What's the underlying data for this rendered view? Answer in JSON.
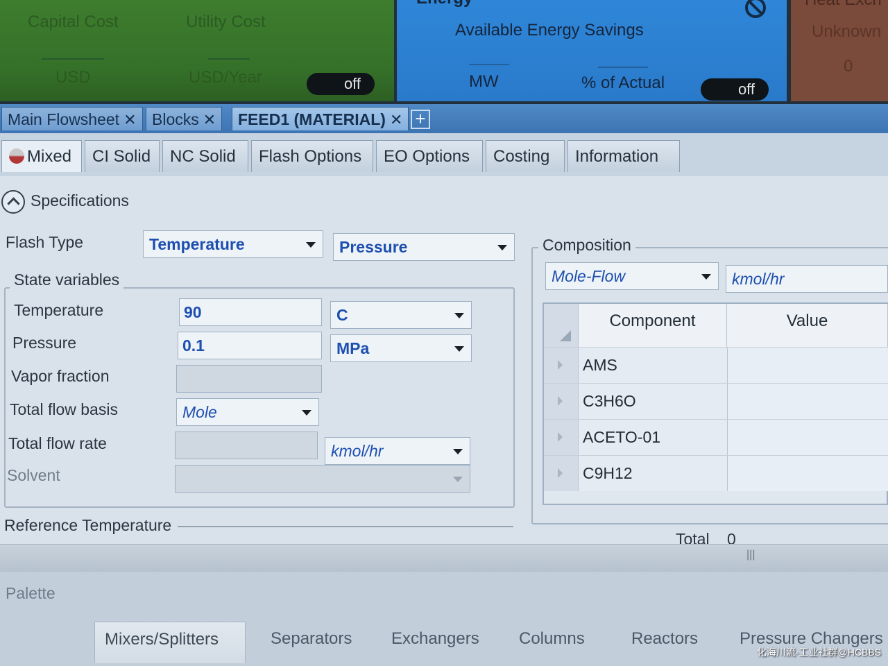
{
  "dashboard": {
    "cost": {
      "col1_title": "Capital Cost",
      "col2_title": "Utility Cost",
      "col1_unit": "USD",
      "col2_unit": "USD/Year",
      "toggle": "off"
    },
    "energy": {
      "title": "Energy",
      "subtitle": "Available Energy Savings",
      "col1_unit": "MW",
      "col2_unit": "% of Actual",
      "toggle": "off"
    },
    "utility": {
      "title": "Heat Exch",
      "subtitle": "Unknown",
      "value": "0"
    }
  },
  "doc_tabs": [
    {
      "label": "Main Flowsheet"
    },
    {
      "label": "Blocks"
    },
    {
      "label": "FEED1 (MATERIAL)"
    }
  ],
  "form_tabs": [
    {
      "label": "Mixed"
    },
    {
      "label": "CI Solid"
    },
    {
      "label": "NC Solid"
    },
    {
      "label": "Flash Options"
    },
    {
      "label": "EO Options"
    },
    {
      "label": "Costing"
    },
    {
      "label": "Information"
    }
  ],
  "specifications": {
    "section_title": "Specifications",
    "flash_type_label": "Flash Type",
    "flash_type_1": "Temperature",
    "flash_type_2": "Pressure",
    "state_variables_title": "State variables",
    "temperature_label": "Temperature",
    "temperature_value": "90",
    "temperature_unit": "C",
    "pressure_label": "Pressure",
    "pressure_value": "0.1",
    "pressure_unit": "MPa",
    "vapor_fraction_label": "Vapor fraction",
    "total_flow_basis_label": "Total flow basis",
    "total_flow_basis_value": "Mole",
    "total_flow_rate_label": "Total flow rate",
    "total_flow_rate_unit": "kmol/hr",
    "solvent_label": "Solvent",
    "reference_temperature_title": "Reference Temperature"
  },
  "composition": {
    "title": "Composition",
    "basis": "Mole-Flow",
    "unit": "kmol/hr",
    "columns": [
      "Component",
      "Value"
    ],
    "rows": [
      {
        "component": "AMS"
      },
      {
        "component": "C3H6O"
      },
      {
        "component": "ACETO-01"
      },
      {
        "component": "C9H12"
      }
    ],
    "total_label": "Total",
    "total_value": "0"
  },
  "palette": {
    "title": "Palette",
    "tabs": [
      "Mixers/Splitters",
      "Separators",
      "Exchangers",
      "Columns",
      "Reactors",
      "Pressure Changers"
    ]
  },
  "watermark": "化海川流-工业社群@HCBBS",
  "colors": {
    "cost_panel": "#3e7d2e",
    "energy_panel": "#2f86d8",
    "input_text": "#1d4fb0"
  }
}
